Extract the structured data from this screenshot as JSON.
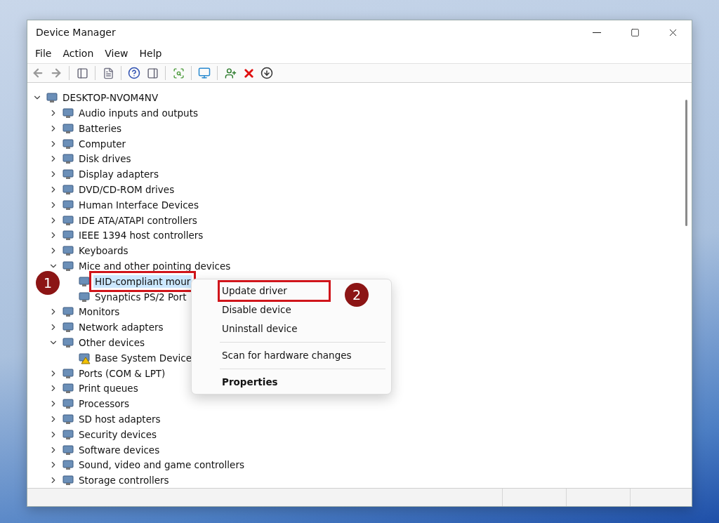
{
  "window": {
    "title": "Device Manager"
  },
  "menu": [
    "File",
    "Action",
    "View",
    "Help"
  ],
  "tree": {
    "label": "DESKTOP-NVOM4NV",
    "expanded": true,
    "children": [
      {
        "label": "Audio inputs and outputs",
        "expanded": false
      },
      {
        "label": "Batteries",
        "expanded": false
      },
      {
        "label": "Computer",
        "expanded": false
      },
      {
        "label": "Disk drives",
        "expanded": false
      },
      {
        "label": "Display adapters",
        "expanded": false
      },
      {
        "label": "DVD/CD-ROM drives",
        "expanded": false
      },
      {
        "label": "Human Interface Devices",
        "expanded": false
      },
      {
        "label": "IDE ATA/ATAPI controllers",
        "expanded": false
      },
      {
        "label": "IEEE 1394 host controllers",
        "expanded": false
      },
      {
        "label": "Keyboards",
        "expanded": false
      },
      {
        "label": "Mice and other pointing devices",
        "expanded": true,
        "children": [
          {
            "label": "HID-compliant mour",
            "selected": true,
            "callout": "1"
          },
          {
            "label": "Synaptics PS/2 Port",
            "selected": false
          }
        ]
      },
      {
        "label": "Monitors",
        "expanded": false
      },
      {
        "label": "Network adapters",
        "expanded": false
      },
      {
        "label": "Other devices",
        "expanded": true,
        "children": [
          {
            "label": "Base System Device",
            "selected": false,
            "warning": true
          }
        ]
      },
      {
        "label": "Ports (COM & LPT)",
        "expanded": false
      },
      {
        "label": "Print queues",
        "expanded": false
      },
      {
        "label": "Processors",
        "expanded": false
      },
      {
        "label": "SD host adapters",
        "expanded": false
      },
      {
        "label": "Security devices",
        "expanded": false
      },
      {
        "label": "Software devices",
        "expanded": false
      },
      {
        "label": "Sound, video and game controllers",
        "expanded": false
      },
      {
        "label": "Storage controllers",
        "expanded": false
      }
    ]
  },
  "context_menu": [
    {
      "kind": "item",
      "label": "Update driver",
      "callout": "2"
    },
    {
      "kind": "item",
      "label": "Disable device"
    },
    {
      "kind": "item",
      "label": "Uninstall device"
    },
    {
      "kind": "separator"
    },
    {
      "kind": "item",
      "label": "Scan for hardware changes"
    },
    {
      "kind": "separator"
    },
    {
      "kind": "item",
      "label": "Properties",
      "bold": true
    }
  ]
}
